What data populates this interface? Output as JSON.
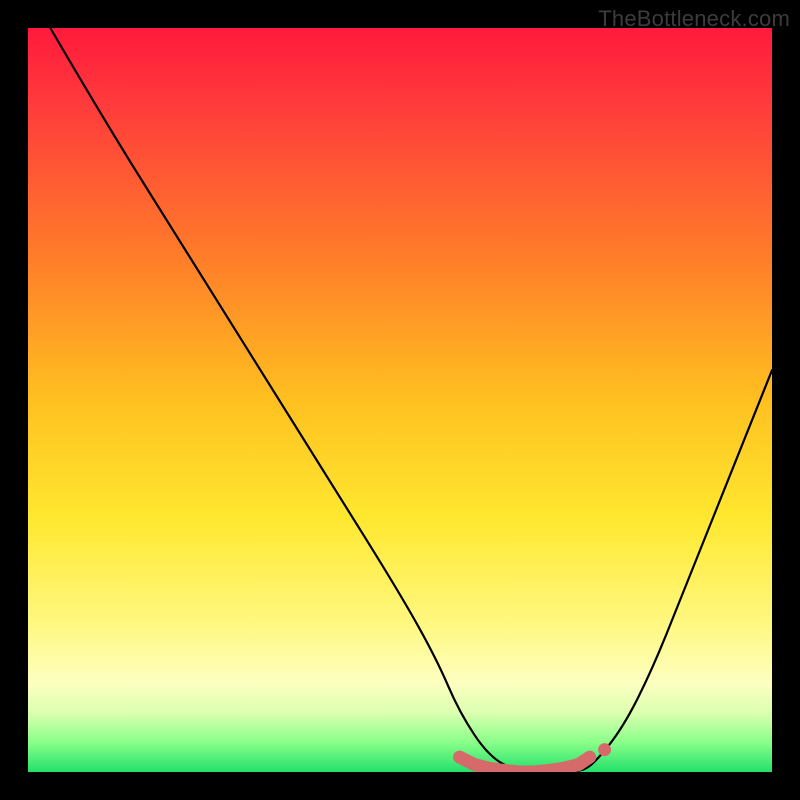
{
  "watermark": "TheBottleneck.com",
  "chart_data": {
    "type": "line",
    "title": "",
    "xlabel": "",
    "ylabel": "",
    "xlim": [
      0,
      100
    ],
    "ylim": [
      0,
      100
    ],
    "grid": false,
    "legend": false,
    "annotations": [],
    "series": [
      {
        "name": "bottleneck-curve",
        "color": "#000000",
        "x": [
          3,
          10,
          20,
          30,
          40,
          50,
          55,
          58,
          62,
          66,
          70,
          74,
          76,
          80,
          84,
          88,
          92,
          96,
          100
        ],
        "y": [
          100,
          88,
          72,
          56,
          40,
          24,
          15,
          8,
          2,
          0,
          0,
          0,
          1,
          6,
          14,
          24,
          34,
          44,
          54
        ]
      }
    ],
    "highlight": {
      "name": "optimal-range",
      "color": "#d66a6a",
      "points_x": [
        58,
        60,
        62,
        64,
        66,
        68,
        70,
        72,
        74,
        75.5
      ],
      "points_y": [
        2.0,
        1.0,
        0.5,
        0.2,
        0.0,
        0.0,
        0.2,
        0.5,
        1.0,
        2.0
      ],
      "endpoint": {
        "x": 77.5,
        "y": 3.0
      }
    },
    "gradient_scale": {
      "description": "Background color encodes bottleneck severity; green=good near bottom, red=bad near top",
      "stops": [
        {
          "pos": 0.0,
          "color": "#ff1a3c"
        },
        {
          "pos": 0.3,
          "color": "#ff7a2a"
        },
        {
          "pos": 0.5,
          "color": "#ffc020"
        },
        {
          "pos": 0.8,
          "color": "#fff880"
        },
        {
          "pos": 0.92,
          "color": "#dcffb0"
        },
        {
          "pos": 1.0,
          "color": "#22e06a"
        }
      ]
    }
  }
}
